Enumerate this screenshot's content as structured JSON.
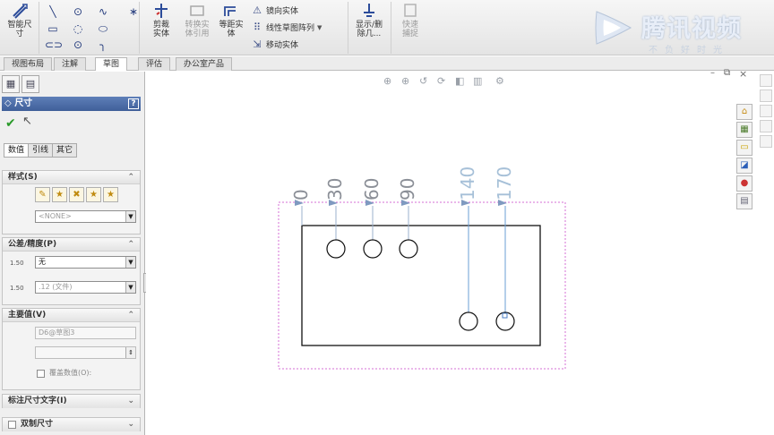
{
  "ribbon": {
    "smart_dim": "智能尺寸",
    "trim": "剪裁实体",
    "convert": "转换实体引用",
    "offset": "等距实体",
    "mirror": "镜向实体",
    "linear_pattern": "线性草图阵列",
    "move": "移动实体",
    "display_delete": "显示/删除几...",
    "rapid_snap": "快速捕捉"
  },
  "logo": {
    "brand": "腾讯视频",
    "slogan": "不负好时光"
  },
  "tabs": [
    "视图布局",
    "注解",
    "草图",
    "评估",
    "办公室产品"
  ],
  "active_tab": "草图",
  "panel": {
    "title": "尺寸",
    "help": "?",
    "sub_tabs": [
      "数值",
      "引线",
      "其它"
    ],
    "style_group": "样式(S)",
    "style_select": "<NONE>",
    "tolerance_group": "公差/精度(P)",
    "tolerance_value": "无",
    "precision_value": ".12 (文件)",
    "tol_icon_label": "1.50",
    "prec_icon_label": "1.50",
    "primary_group": "主要值(V)",
    "primary_value": "D6@草图3",
    "override_label": "覆盖数值(O):",
    "text_group": "标注尺寸文字(I)",
    "dual_group": "双制尺寸"
  },
  "canvas": {
    "dimensions": [
      "0",
      "30",
      "60",
      "90",
      "140",
      "170"
    ]
  },
  "icons": {
    "view_toolbar": [
      "zoom-fit-icon",
      "zoom-area-icon",
      "previous-view-icon",
      "rotate-icon",
      "section-view-icon",
      "display-style-icon",
      "view-settings-icon"
    ],
    "task_pane": [
      "home-icon",
      "parts-library-icon",
      "file-explorer-icon",
      "view-palette-icon",
      "appearance-icon",
      "custom-properties-icon"
    ]
  }
}
